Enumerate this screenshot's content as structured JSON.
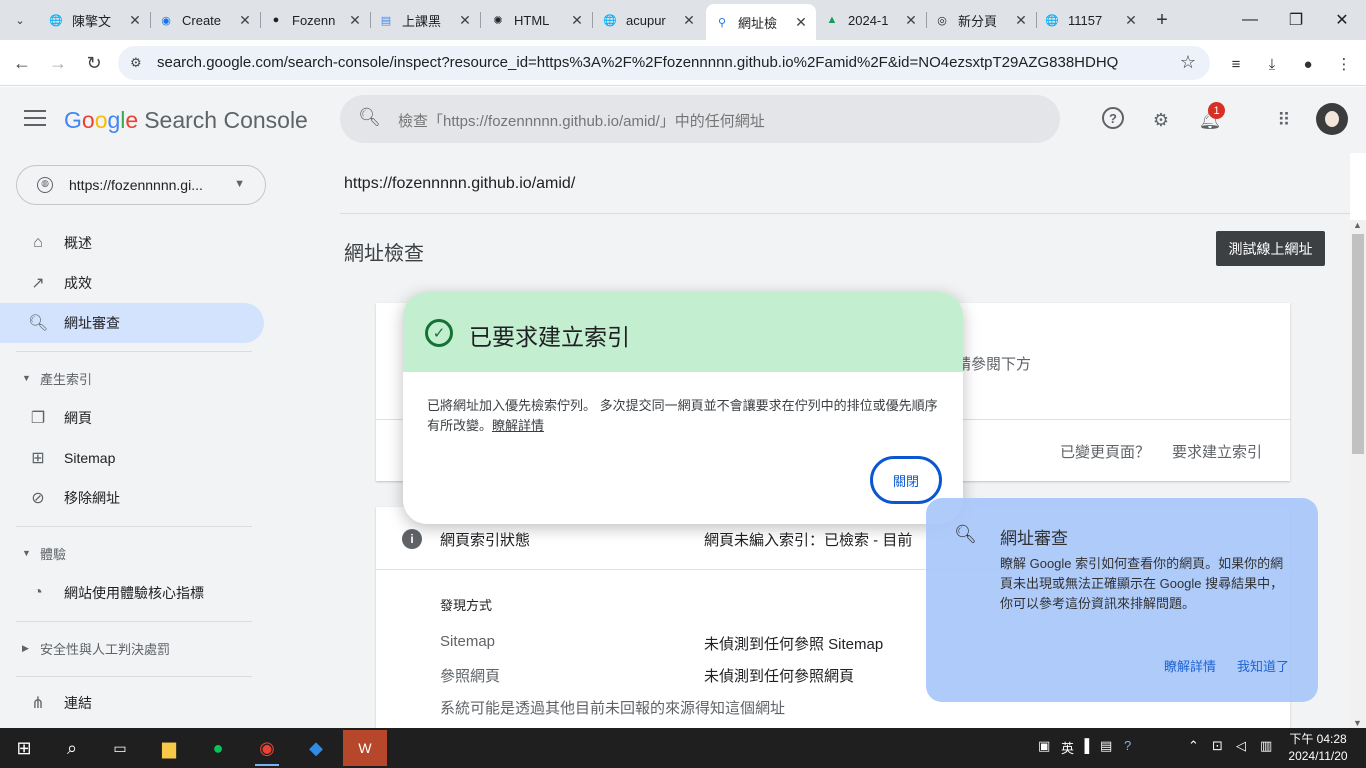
{
  "browser": {
    "tabs": [
      {
        "title": "陳擎文",
        "icon": "globe-icon"
      },
      {
        "title": "Create",
        "icon": "globe-icon"
      },
      {
        "title": "Fozenn",
        "icon": "github-icon"
      },
      {
        "title": "上課黑",
        "icon": "docs-icon"
      },
      {
        "title": "HTML",
        "icon": "openai-icon"
      },
      {
        "title": "acupur",
        "icon": "globe-icon"
      },
      {
        "title": "網址檢",
        "icon": "search-console-icon"
      },
      {
        "title": "2024-1",
        "icon": "drive-icon"
      },
      {
        "title": "新分頁",
        "icon": "chrome-icon"
      },
      {
        "title": "11157",
        "icon": "globe-icon"
      }
    ],
    "url": "search.google.com/search-console/inspect?resource_id=https%3A%2F%2Ffozennnnn.github.io%2Famid%2F&id=NO4ezsxtpT29AZG838HDHQ"
  },
  "header": {
    "logo_google": [
      "G",
      "o",
      "o",
      "g",
      "l",
      "e"
    ],
    "product": "Search Console",
    "search_placeholder": "檢查「https://fozennnnn.github.io/amid/」中的任何網址",
    "notification_count": "1"
  },
  "sidebar": {
    "property": "https://fozennnnn.gi...",
    "items": [
      {
        "label": "概述",
        "icon": "home-icon"
      },
      {
        "label": "成效",
        "icon": "trending-icon"
      },
      {
        "label": "網址審查",
        "icon": "search-icon"
      }
    ],
    "section_indexing": "產生索引",
    "indexing_items": [
      {
        "label": "網頁",
        "icon": "pages-icon"
      },
      {
        "label": "Sitemap",
        "icon": "sitemap-icon"
      },
      {
        "label": "移除網址",
        "icon": "visibility-off-icon"
      }
    ],
    "section_experience": "體驗",
    "experience_items": [
      {
        "label": "網站使用體驗核心指標",
        "icon": "speed-icon"
      }
    ],
    "section_security": "安全性與人工判決處罰",
    "links_label": "連結"
  },
  "main": {
    "url": "https://fozennnnn.github.io/amid/",
    "title": "網址檢查",
    "test_live_button": "測試線上網址",
    "card1_partial": "請參閱下方",
    "changed_page": "已變更頁面？",
    "request_index": "要求建立索引",
    "index_status_label": "網頁索引狀態",
    "index_status_value": "網頁未編入索引：已檢索 - 目前",
    "discovery_title": "發現方式",
    "rows": [
      {
        "label": "Sitemap",
        "value": "未偵測到任何參照 Sitemap"
      },
      {
        "label": "參照網頁",
        "value": "未偵測到任何參照網頁"
      }
    ],
    "note": "系統可能是透過其他目前未回報的來源得知這個網址"
  },
  "dialog": {
    "title": "已要求建立索引",
    "body": "已將網址加入優先檢索佇列。 多次提交同一網頁並不會讓要求在佇列中的排位或優先順序有所改變。",
    "link": "瞭解詳情",
    "close": "關閉"
  },
  "tip": {
    "title": "網址審查",
    "body": "瞭解 Google 索引如何查看你的網頁。如果你的網頁未出現或無法正確顯示在 Google 搜尋結果中，你可以參考這份資訊來排解問題。",
    "learn_more": "瞭解詳情",
    "got_it": "我知道了"
  },
  "taskbar": {
    "ime": "英",
    "time": "下午 04:28",
    "date": "2024/11/20"
  },
  "colors": {
    "dialog_header": "#c4eed0",
    "accent": "#0b57d0",
    "active_nav": "#d3e3fd",
    "tip_card": "#a8c7fa"
  }
}
